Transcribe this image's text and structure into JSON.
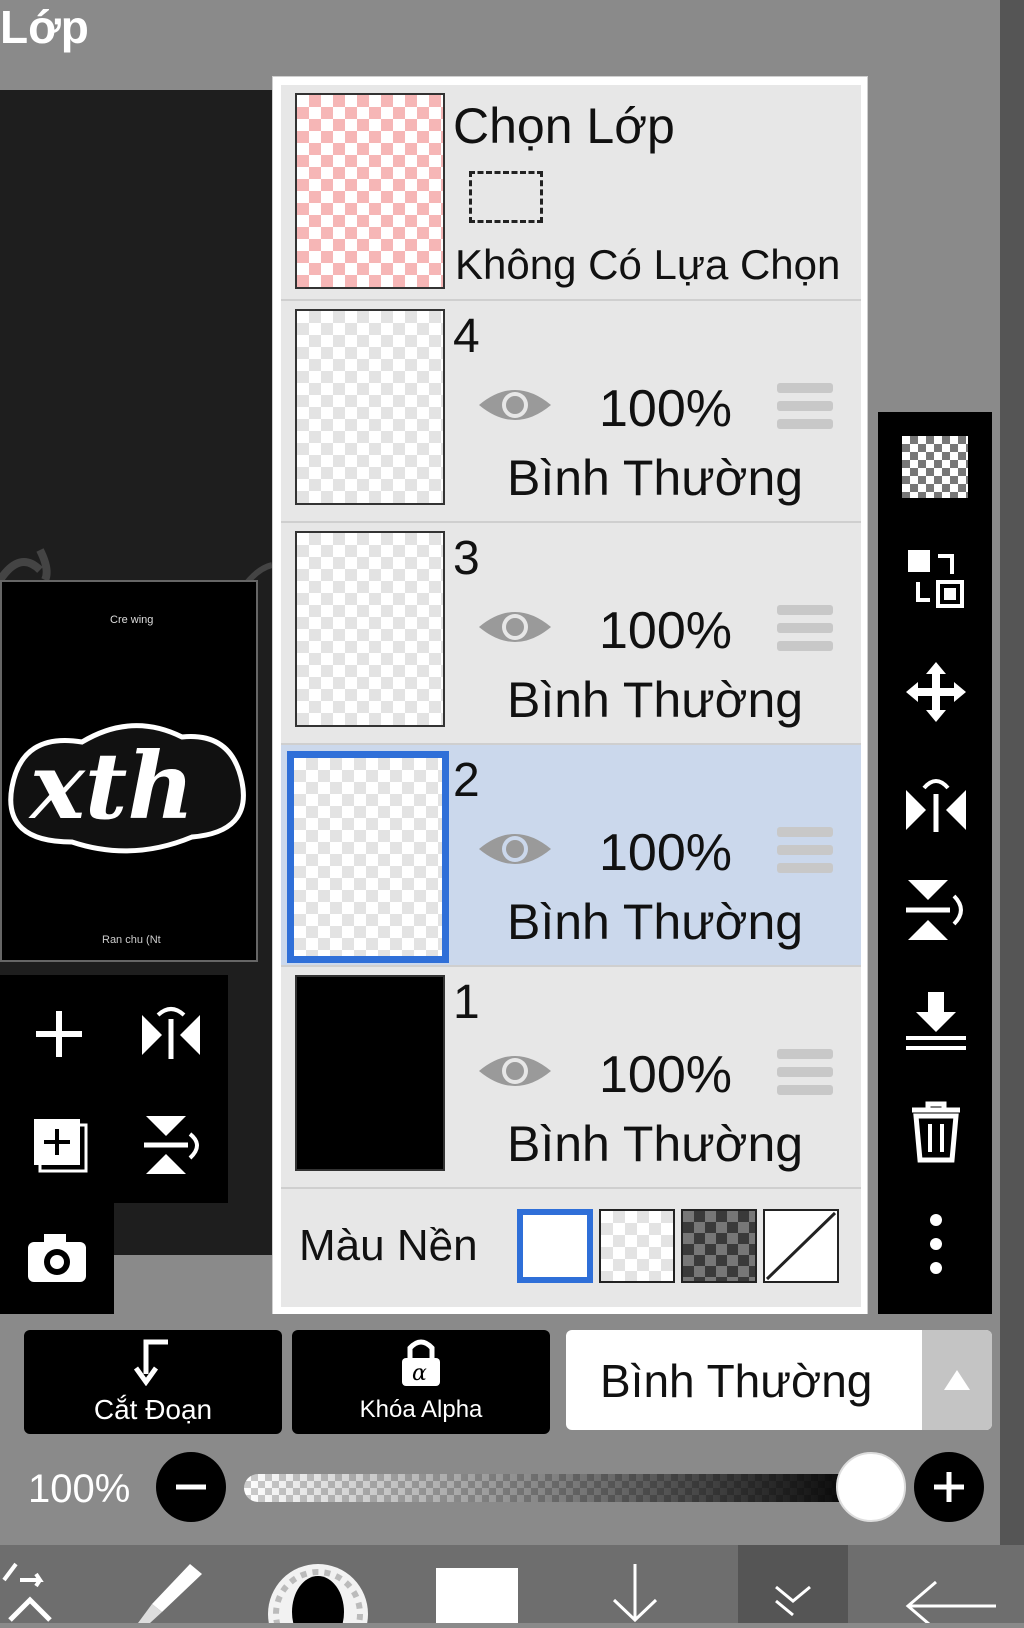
{
  "title": "Lớp",
  "selection_layer": {
    "title": "Chọn Lớp",
    "status": "Không Có Lựa Chọn"
  },
  "layers": [
    {
      "name": "4",
      "opacity": "100%",
      "blend": "Bình Thường",
      "selected": false
    },
    {
      "name": "3",
      "opacity": "100%",
      "blend": "Bình Thường",
      "selected": false
    },
    {
      "name": "2",
      "opacity": "100%",
      "blend": "Bình Thường",
      "selected": true
    },
    {
      "name": "1",
      "opacity": "100%",
      "blend": "Bình Thường",
      "selected": false
    }
  ],
  "background": {
    "label": "Màu Nền"
  },
  "actions": {
    "clip": "Cắt Đoạn",
    "alpha_lock": "Khóa Alpha",
    "blend_mode": "Bình Thường"
  },
  "opacity_slider": {
    "label": "100%",
    "value": 1.0
  },
  "preview": {
    "caption_top": "Cre wing",
    "art_text": "xth",
    "caption_bottom": "Ran chu (Nt"
  },
  "colors": {
    "selected_bg": "#cbd8ec",
    "accent": "#2f6fd8",
    "panel_bg": "#e7e7e7"
  }
}
